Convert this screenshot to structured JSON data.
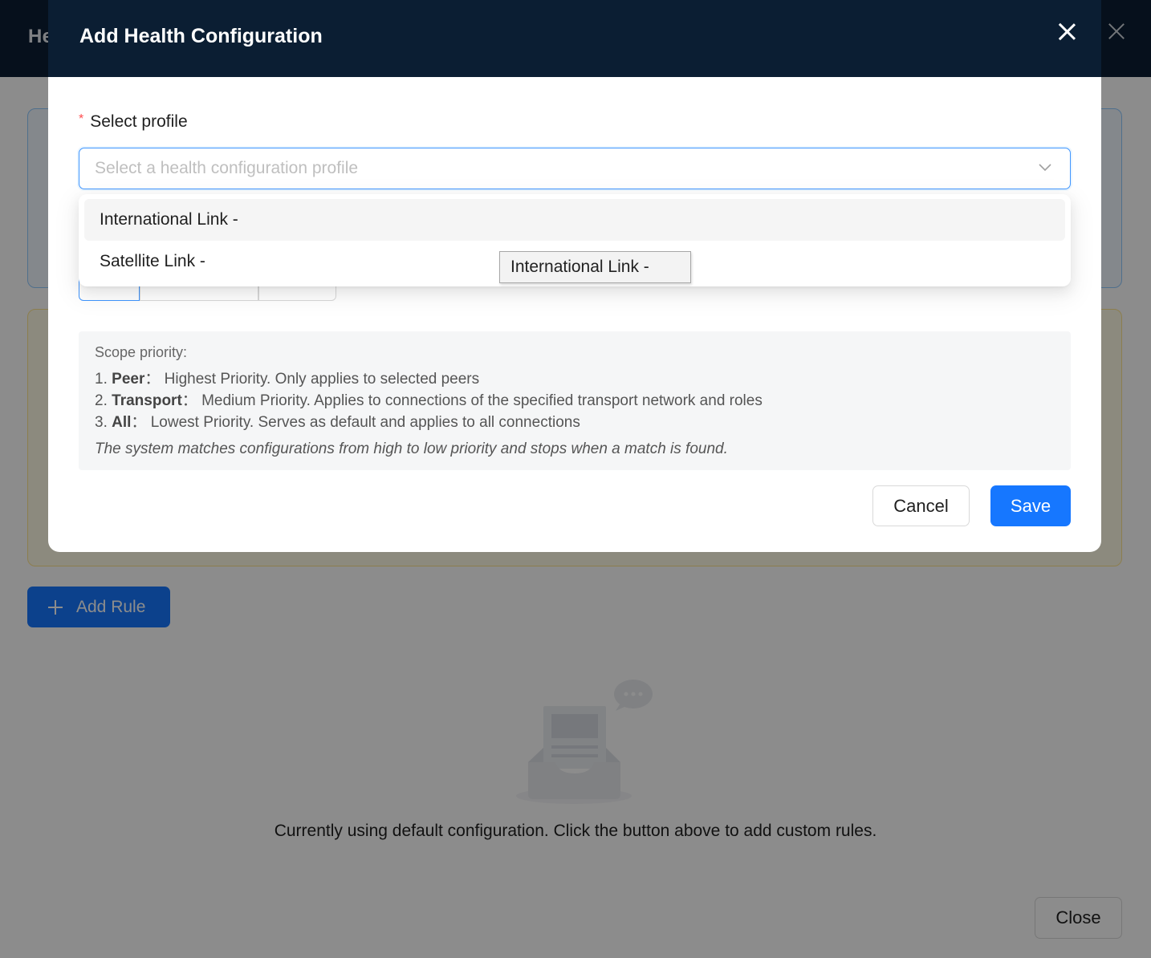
{
  "background": {
    "drawer_title_partial": "He",
    "add_rule_label": "Add Rule",
    "empty_text": "Currently using default configuration. Click the button above to add custom rules.",
    "close_label": "Close"
  },
  "modal": {
    "title": "Add Health Configuration",
    "field": {
      "required_mark": "*",
      "label": "Select profile",
      "placeholder": "Select a health configuration profile"
    },
    "dropdown": {
      "options": [
        {
          "label": "International Link -",
          "active": true
        },
        {
          "label": "Satellite Link -",
          "active": false
        }
      ],
      "tooltip": "International Link -"
    },
    "info": {
      "title": "Scope priority:",
      "items": [
        {
          "num": "1.",
          "name": "Peer",
          "sep": "：",
          "text": "Highest Priority. Only applies to selected peers"
        },
        {
          "num": "2.",
          "name": "Transport",
          "sep": "：",
          "text": "Medium Priority. Applies to connections of the specified transport network and roles"
        },
        {
          "num": "3.",
          "name": "All",
          "sep": "：",
          "text": "Lowest Priority. Serves as default and applies to all connections"
        }
      ],
      "note": "The system matches configurations from high to low priority and stops when a match is found."
    },
    "buttons": {
      "cancel": "Cancel",
      "save": "Save"
    }
  },
  "colors": {
    "header_bg": "#0b1e33",
    "primary": "#1677ff",
    "required": "#ff4d4f"
  }
}
